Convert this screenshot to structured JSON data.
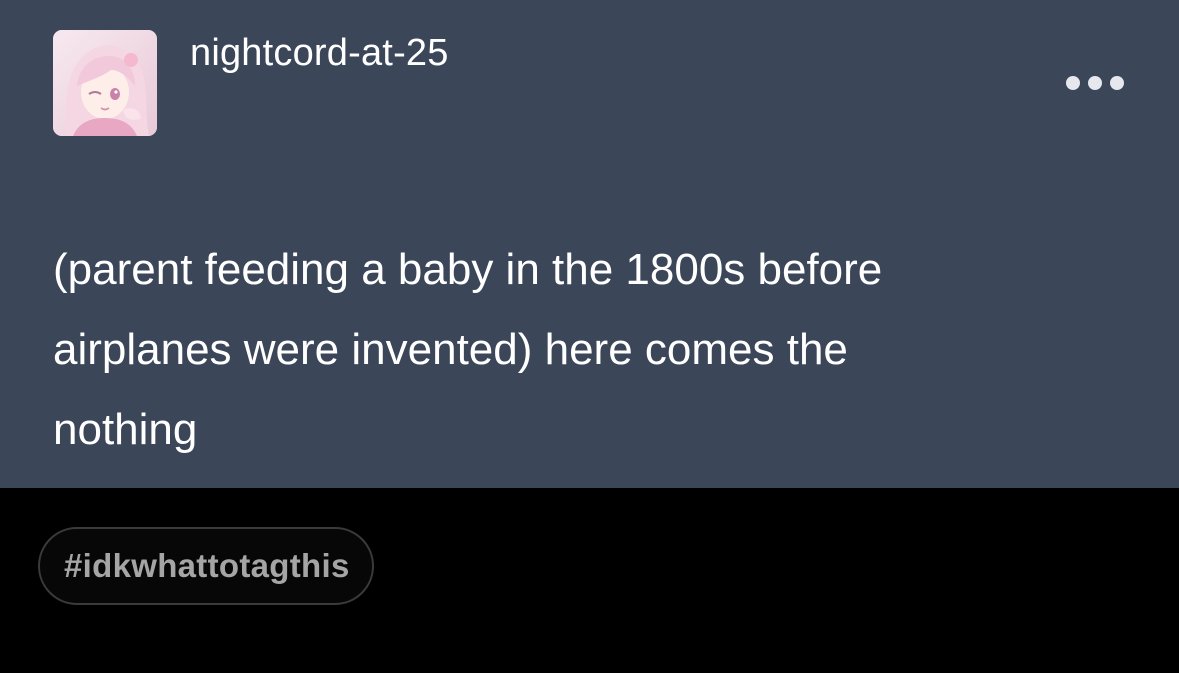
{
  "post": {
    "username": "nightcord-at-25",
    "avatar_icon": "anime-character-avatar",
    "more_icon": "ellipsis-icon",
    "body_lines": [
      "(parent feeding a baby in the 1800s before",
      "airplanes were invented) here comes the",
      "nothing"
    ]
  },
  "tags": [
    "#idkwhattotagthis"
  ],
  "colors": {
    "post_background": "#3b4659",
    "page_background": "#000000",
    "text": "#ffffff",
    "tag_text": "#a5a5a5"
  }
}
